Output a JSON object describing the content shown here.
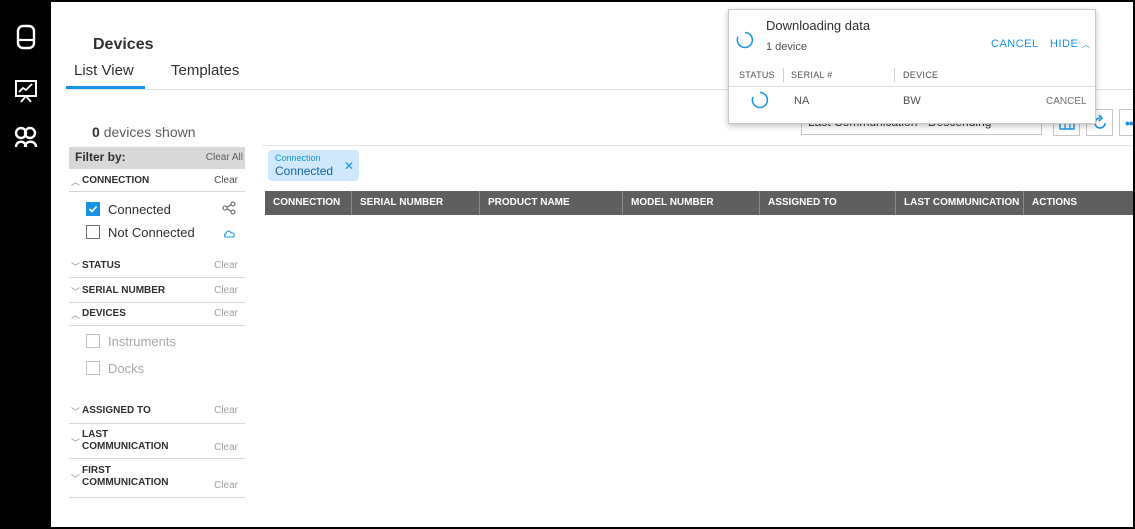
{
  "page": {
    "title": "Devices"
  },
  "tabs": [
    {
      "label": "List View",
      "active": true
    },
    {
      "label": "Templates",
      "active": false
    }
  ],
  "summary": {
    "count": "0",
    "suffix": "devices shown"
  },
  "filter": {
    "heading": "Filter by:",
    "clear_all": "Clear All",
    "sections": {
      "connection": {
        "label": "CONNECTION",
        "clear": "Clear",
        "expanded": true
      },
      "status": {
        "label": "STATUS",
        "clear": "Clear"
      },
      "serial_number": {
        "label": "SERIAL NUMBER",
        "clear": "Clear"
      },
      "devices": {
        "label": "DEVICES",
        "clear": "Clear",
        "expanded": true
      },
      "assigned_to": {
        "label": "ASSIGNED TO",
        "clear": "Clear"
      },
      "last_communication": {
        "label_line1": "LAST",
        "label_line2": "COMMUNICATION",
        "clear": "Clear"
      },
      "first_communication": {
        "label_line1": "FIRST",
        "label_line2": "COMMUNICATION",
        "clear": "Clear"
      }
    },
    "options": {
      "connected": {
        "label": "Connected",
        "checked": true
      },
      "not_connected": {
        "label": "Not Connected",
        "checked": false
      },
      "instruments": {
        "label": "Instruments",
        "checked": false,
        "disabled": true
      },
      "docks": {
        "label": "Docks",
        "checked": false,
        "disabled": true
      }
    }
  },
  "active_filter_chip": {
    "key": "Connection",
    "value": "Connected"
  },
  "table": {
    "columns": [
      "CONNECTION",
      "SERIAL NUMBER",
      "PRODUCT NAME",
      "MODEL NUMBER",
      "ASSIGNED TO",
      "LAST COMMUNICATION",
      "ACTIONS"
    ]
  },
  "toolbar": {
    "sort_label": "Last Communication - Descending"
  },
  "download_popup": {
    "title": "Downloading data",
    "subtitle": "1 device",
    "cancel_label": "CANCEL",
    "hide_label": "HIDE",
    "columns": [
      "STATUS",
      "SERIAL #",
      "DEVICE"
    ],
    "row": {
      "serial": "NA",
      "device": "BW",
      "cancel_label": "CANCEL"
    }
  },
  "colors": {
    "accent": "#1792e5",
    "table_header": "#5f5f5f",
    "rail": "#000000",
    "chip_bg": "#cfe8fb"
  },
  "icons": {
    "rail": [
      "device-icon",
      "dashboard-icon",
      "groups-icon"
    ],
    "connected": "share-network-icon",
    "not_connected": "cloud-icon",
    "toolbar": [
      "grid-view-icon",
      "refresh-icon",
      "more-icon"
    ],
    "popup_status": "spinner-icon"
  }
}
